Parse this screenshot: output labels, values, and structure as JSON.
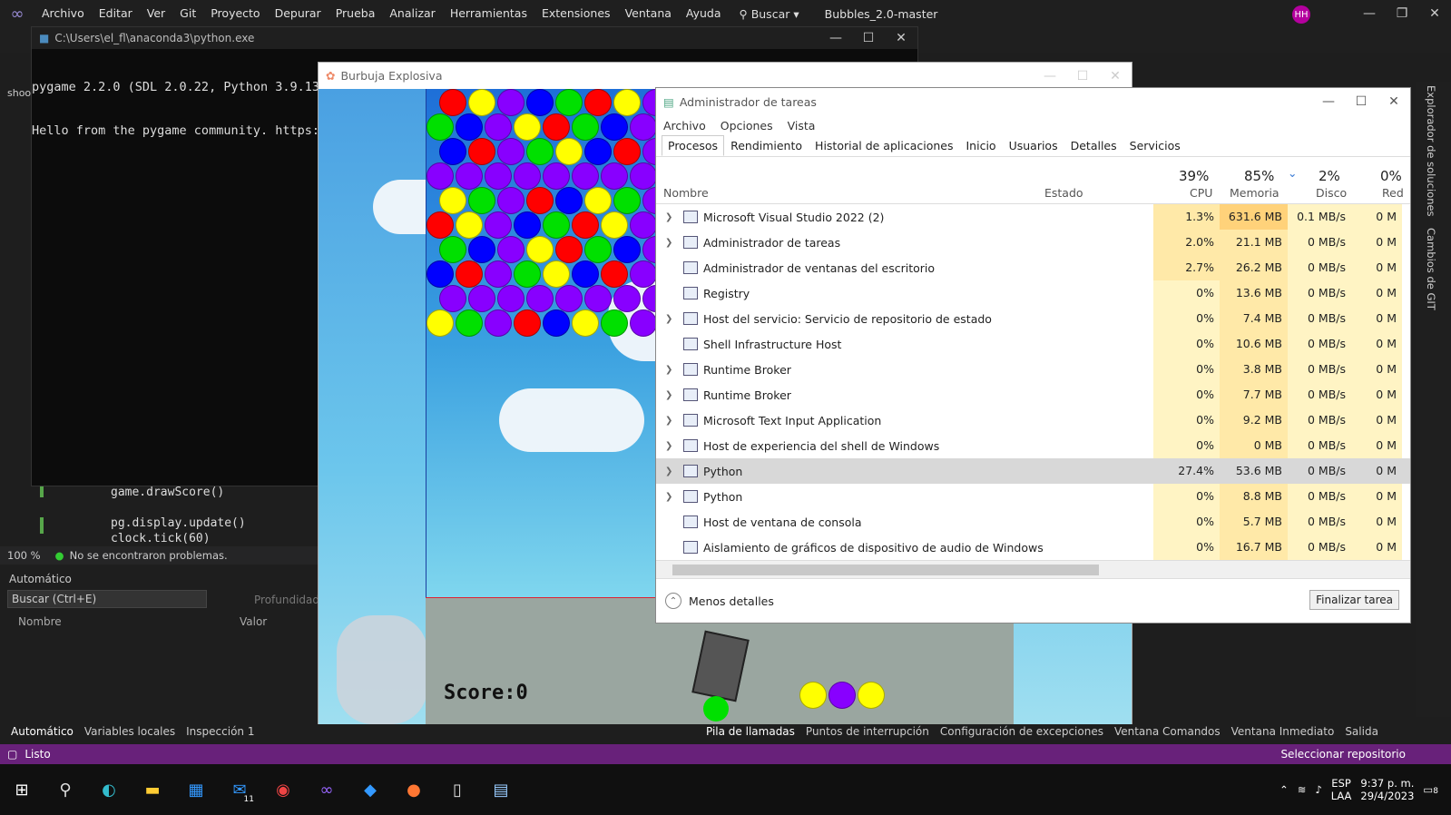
{
  "vs": {
    "menu": [
      "Archivo",
      "Editar",
      "Ver",
      "Git",
      "Proyecto",
      "Depurar",
      "Prueba",
      "Analizar",
      "Herramientas",
      "Extensiones",
      "Ventana",
      "Ayuda"
    ],
    "search_label": "Buscar",
    "solution_name": "Bubbles_2.0-master",
    "avatar_initials": "HH",
    "zoom": "100 %",
    "problems_text": "No se encontraron problemas.",
    "code_lines": [
      "game.drawScore()",
      "",
      "pg.display.update()",
      "clock.tick(60)"
    ],
    "auto_title": "Automático",
    "auto_search_placeholder": "Buscar (Ctrl+E)",
    "depth_label": "Profundidad",
    "auto_col_name": "Nombre",
    "auto_col_value": "Valor",
    "bottom_tabs_left": [
      "Automático",
      "Variables locales",
      "Inspección 1"
    ],
    "bottom_tabs_right": [
      "Pila de llamadas",
      "Puntos de interrupción",
      "Configuración de excepciones",
      "Ventana Comandos",
      "Ventana Inmediato",
      "Salida"
    ],
    "status_ready": "Listo",
    "status_repo": "Seleccionar repositorio",
    "side_tabs": [
      "Explorador de soluciones",
      "Cambios de GIT"
    ],
    "tab_partial": "shoo"
  },
  "console": {
    "title": "C:\\Users\\el_fl\\anaconda3\\python.exe",
    "lines": [
      "pygame 2.2.0 (SDL 2.0.22, Python 3.9.13)",
      "Hello from the pygame community. https:/"
    ]
  },
  "game": {
    "title": "Burbuja Explosiva",
    "score_text": "Score:0",
    "colors": {
      "red": "#ff0000",
      "blue": "#0000ff",
      "yellow": "#ffff00",
      "green": "#00e000",
      "purple": "#8800ff"
    }
  },
  "taskmgr": {
    "title": "Administrador de tareas",
    "menu": [
      "Archivo",
      "Opciones",
      "Vista"
    ],
    "tabs": [
      "Procesos",
      "Rendimiento",
      "Historial de aplicaciones",
      "Inicio",
      "Usuarios",
      "Detalles",
      "Servicios"
    ],
    "col_name": "Nombre",
    "col_status": "Estado",
    "cpu_pct": "39%",
    "cpu_label": "CPU",
    "mem_pct": "85%",
    "mem_label": "Memoria",
    "disk_pct": "2%",
    "disk_label": "Disco",
    "net_pct": "0%",
    "net_label": "Red",
    "rows": [
      {
        "name": "Microsoft Visual Studio 2022 (2)",
        "exp": true,
        "cpu": "1.3%",
        "mem": "631.6 MB",
        "disk": "0.1 MB/s",
        "net": "0 M"
      },
      {
        "name": "Administrador de tareas",
        "exp": true,
        "cpu": "2.0%",
        "mem": "21.1 MB",
        "disk": "0 MB/s",
        "net": "0 M"
      },
      {
        "name": "Administrador de ventanas del escritorio",
        "exp": false,
        "cpu": "2.7%",
        "mem": "26.2 MB",
        "disk": "0 MB/s",
        "net": "0 M"
      },
      {
        "name": "Registry",
        "exp": false,
        "cpu": "0%",
        "mem": "13.6 MB",
        "disk": "0 MB/s",
        "net": "0 M"
      },
      {
        "name": "Host del servicio: Servicio de repositorio de estado",
        "exp": true,
        "cpu": "0%",
        "mem": "7.4 MB",
        "disk": "0 MB/s",
        "net": "0 M"
      },
      {
        "name": "Shell Infrastructure Host",
        "exp": false,
        "cpu": "0%",
        "mem": "10.6 MB",
        "disk": "0 MB/s",
        "net": "0 M"
      },
      {
        "name": "Runtime Broker",
        "exp": true,
        "cpu": "0%",
        "mem": "3.8 MB",
        "disk": "0 MB/s",
        "net": "0 M"
      },
      {
        "name": "Runtime Broker",
        "exp": true,
        "cpu": "0%",
        "mem": "7.7 MB",
        "disk": "0 MB/s",
        "net": "0 M"
      },
      {
        "name": "Microsoft Text Input Application",
        "exp": true,
        "cpu": "0%",
        "mem": "9.2 MB",
        "disk": "0 MB/s",
        "net": "0 M"
      },
      {
        "name": "Host de experiencia del shell de Windows",
        "exp": true,
        "cpu": "0%",
        "mem": "0 MB",
        "disk": "0 MB/s",
        "net": "0 M"
      },
      {
        "name": "Python",
        "exp": true,
        "cpu": "27.4%",
        "mem": "53.6 MB",
        "disk": "0 MB/s",
        "net": "0 M",
        "selected": true
      },
      {
        "name": "Python",
        "exp": true,
        "cpu": "0%",
        "mem": "8.8 MB",
        "disk": "0 MB/s",
        "net": "0 M"
      },
      {
        "name": "Host de ventana de consola",
        "exp": false,
        "cpu": "0%",
        "mem": "5.7 MB",
        "disk": "0 MB/s",
        "net": "0 M"
      },
      {
        "name": "Aislamiento de gráficos de dispositivo de audio de Windows",
        "exp": false,
        "cpu": "0%",
        "mem": "16.7 MB",
        "disk": "0 MB/s",
        "net": "0 M"
      }
    ],
    "fewer_details": "Menos detalles",
    "end_task": "Finalizar tarea"
  },
  "taskbar": {
    "lang_top": "ESP",
    "lang_bottom": "LAA",
    "time": "9:37 p. m.",
    "date": "29/4/2023",
    "notif_count": "8",
    "teams_badge": "11"
  }
}
